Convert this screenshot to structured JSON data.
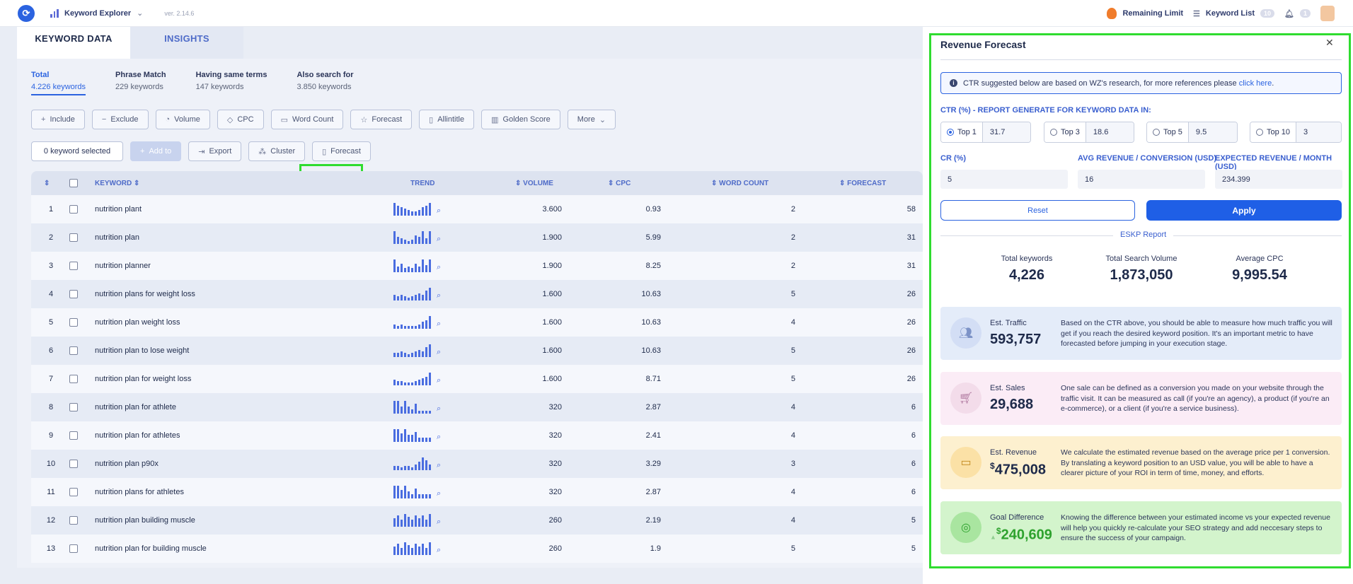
{
  "topbar": {
    "tool_name": "Keyword Explorer",
    "version": "ver. 2.14.6",
    "remaining_limit": "Remaining Limit",
    "keyword_list": "Keyword List",
    "keyword_list_count": "10",
    "notification_count": "1"
  },
  "tabs": [
    {
      "label": "KEYWORD DATA",
      "active": true
    },
    {
      "label": "INSIGHTS",
      "active": false
    }
  ],
  "subtabs": [
    {
      "title": "Total",
      "sub": "4.226 keywords"
    },
    {
      "title": "Phrase Match",
      "sub": "229 keywords"
    },
    {
      "title": "Having same terms",
      "sub": "147 keywords"
    },
    {
      "title": "Also search for",
      "sub": "3.850 keywords"
    }
  ],
  "filters": [
    {
      "icon": "plus-icon",
      "label": "Include"
    },
    {
      "icon": "minus-icon",
      "label": "Exclude"
    },
    {
      "icon": "volume-icon",
      "label": "Volume"
    },
    {
      "icon": "cpc-icon",
      "label": "CPC"
    },
    {
      "icon": "word-count-icon",
      "label": "Word Count"
    },
    {
      "icon": "star-icon",
      "label": "Forecast"
    },
    {
      "icon": "document-icon",
      "label": "Allintitle"
    },
    {
      "icon": "chart-icon",
      "label": "Golden Score"
    },
    {
      "icon": "chevron-down-icon",
      "label": "More"
    }
  ],
  "actions": {
    "selected": "0 keyword selected",
    "add_to": "Add to",
    "export": "Export",
    "cluster": "Cluster",
    "forecast": "Forecast"
  },
  "table": {
    "headers": {
      "keyword": "KEYWORD",
      "trend": "TREND",
      "volume": "VOLUME",
      "cpc": "CPC",
      "word_count": "WORD COUNT",
      "forecast": "FORECAST"
    },
    "rows": [
      {
        "n": "1",
        "keyword": "nutrition plant",
        "volume": "3.600",
        "cpc": "0.93",
        "wc": "2",
        "forecast": "58",
        "trend": [
          9,
          7,
          6,
          5,
          4,
          3,
          3,
          4,
          6,
          7,
          9
        ]
      },
      {
        "n": "2",
        "keyword": "nutrition plan",
        "volume": "1.900",
        "cpc": "5.99",
        "wc": "2",
        "forecast": "31",
        "trend": [
          9,
          5,
          4,
          3,
          2,
          3,
          6,
          5,
          9,
          4,
          9
        ]
      },
      {
        "n": "3",
        "keyword": "nutrition planner",
        "volume": "1.900",
        "cpc": "8.25",
        "wc": "2",
        "forecast": "31",
        "trend": [
          9,
          4,
          6,
          3,
          4,
          3,
          6,
          4,
          9,
          5,
          9
        ]
      },
      {
        "n": "4",
        "keyword": "nutrition plans for weight loss",
        "volume": "1.600",
        "cpc": "10.63",
        "wc": "5",
        "forecast": "26",
        "trend": [
          4,
          3,
          4,
          3,
          2,
          3,
          4,
          5,
          4,
          7,
          9
        ]
      },
      {
        "n": "5",
        "keyword": "nutrition plan weight loss",
        "volume": "1.600",
        "cpc": "10.63",
        "wc": "4",
        "forecast": "26",
        "trend": [
          3,
          2,
          3,
          2,
          2,
          2,
          2,
          3,
          5,
          6,
          9
        ]
      },
      {
        "n": "6",
        "keyword": "nutrition plan to lose weight",
        "volume": "1.600",
        "cpc": "10.63",
        "wc": "5",
        "forecast": "26",
        "trend": [
          3,
          3,
          4,
          3,
          2,
          3,
          4,
          5,
          4,
          7,
          9
        ]
      },
      {
        "n": "7",
        "keyword": "nutrition plan for weight loss",
        "volume": "1.600",
        "cpc": "8.71",
        "wc": "5",
        "forecast": "26",
        "trend": [
          4,
          3,
          3,
          2,
          2,
          2,
          3,
          4,
          5,
          6,
          9
        ]
      },
      {
        "n": "8",
        "keyword": "nutrition plan for athlete",
        "volume": "320",
        "cpc": "2.87",
        "wc": "4",
        "forecast": "6",
        "trend": [
          9,
          9,
          5,
          9,
          5,
          3,
          7,
          2,
          2,
          2,
          2
        ]
      },
      {
        "n": "9",
        "keyword": "nutrition plan for athletes",
        "volume": "320",
        "cpc": "2.41",
        "wc": "4",
        "forecast": "6",
        "trend": [
          9,
          9,
          6,
          9,
          5,
          5,
          7,
          3,
          3,
          3,
          3
        ]
      },
      {
        "n": "10",
        "keyword": "nutrition plan p90x",
        "volume": "320",
        "cpc": "3.29",
        "wc": "3",
        "forecast": "6",
        "trend": [
          3,
          3,
          2,
          3,
          3,
          2,
          4,
          6,
          9,
          7,
          4
        ]
      },
      {
        "n": "11",
        "keyword": "nutrition plans for athletes",
        "volume": "320",
        "cpc": "2.87",
        "wc": "4",
        "forecast": "6",
        "trend": [
          9,
          9,
          6,
          9,
          5,
          3,
          7,
          3,
          3,
          3,
          3
        ]
      },
      {
        "n": "12",
        "keyword": "nutrition plan building muscle",
        "volume": "260",
        "cpc": "2.19",
        "wc": "4",
        "forecast": "5",
        "trend": [
          6,
          8,
          5,
          9,
          7,
          5,
          8,
          6,
          8,
          5,
          9
        ]
      },
      {
        "n": "13",
        "keyword": "nutrition plan for building muscle",
        "volume": "260",
        "cpc": "1.9",
        "wc": "5",
        "forecast": "5",
        "trend": [
          6,
          8,
          5,
          9,
          7,
          5,
          8,
          6,
          8,
          5,
          9
        ]
      }
    ]
  },
  "panel": {
    "title": "Revenue Forecast",
    "info_text": "CTR suggested below are based on WZ's research, for more references please",
    "info_link": "click here",
    "info_dot": ".",
    "ctr_title": "CTR (%) - REPORT GENERATE FOR KEYWORD DATA IN:",
    "ctr": [
      {
        "label": "Top 1",
        "value": "31.7",
        "checked": true
      },
      {
        "label": "Top 3",
        "value": "18.6",
        "checked": false
      },
      {
        "label": "Top 5",
        "value": "9.5",
        "checked": false
      },
      {
        "label": "Top 10",
        "value": "3",
        "checked": false
      }
    ],
    "cr_label": "CR (%)",
    "cr_value": "5",
    "avg_label": "AVG REVENUE / CONVERSION (USD)",
    "avg_value": "16",
    "exp_label": "EXPECTED REVENUE / MONTH (USD)",
    "exp_value": "234.399",
    "reset": "Reset",
    "apply": "Apply",
    "report_title": "ESKP Report",
    "stats": [
      {
        "label": "Total keywords",
        "value": "4,226"
      },
      {
        "label": "Total Search Volume",
        "value": "1,873,050"
      },
      {
        "label": "Average CPC",
        "value": "9,995.54"
      }
    ],
    "cards": [
      {
        "label": "Est. Traffic",
        "value": "593,757",
        "prefix": "",
        "desc": "Based on the CTR above, you should be able to measure how much traffic you will get if you reach the desired keyword position. It's an important metric to have forecasted before jumping in your execution stage.",
        "bg": "#e4ecf9",
        "circle": "#d3def5",
        "color": "#1e2a4a"
      },
      {
        "label": "Est. Sales",
        "value": "29,688",
        "prefix": "",
        "desc": "One sale can be defined as a conversion you made on your website through the traffic visit. It can be measured as call (if you're an agency), a product (if you're an e-commerce), or a client (if you're a service business).",
        "bg": "#fbecf6",
        "circle": "#f3dcea",
        "color": "#1e2a4a"
      },
      {
        "label": "Est. Revenue",
        "value": "475,008",
        "prefix": "$",
        "desc": "We calculate the estimated revenue based on the average price per 1 conversion. By translating a keyword position to an USD value, you will be able to have a clearer picture of your ROI in term of time, money, and efforts.",
        "bg": "#fdf0cf",
        "circle": "#fbe1a6",
        "color": "#1e2a4a"
      },
      {
        "label": "Goal Difference",
        "value": "240,609",
        "prefix": "$",
        "desc": "Knowing the difference between your estimated income vs your expected revenue will help you quickly re-calculate your SEO strategy and add neccesary steps to ensure the success of your campaign.",
        "bg": "#d3f4cc",
        "circle": "#a9e5a0",
        "color": "#2ea22e"
      }
    ]
  }
}
